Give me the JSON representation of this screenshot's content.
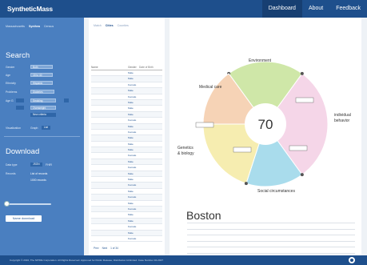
{
  "app": {
    "brand": "SyntheticMass",
    "nav": [
      "Dashboard",
      "About",
      "Feedback"
    ],
    "footer": "Copyright © 2016, The MITRE Corporation. All Rights Reserved. Approved for Public Release; Distribution Unlimited. Case Number 16-2027"
  },
  "sidebar": {
    "subtabs": [
      "Massachusetts",
      "Synthea",
      "Census"
    ],
    "search_title": "Search",
    "fields": [
      {
        "label": "Gender",
        "value": "Both"
      },
      {
        "label": "Age",
        "value": "18 to 40"
      },
      {
        "label": "Ethnicity",
        "value": "Hispanic"
      },
      {
        "label": "Problems",
        "value": "Diabetes"
      }
    ],
    "row5_label": "Age G",
    "row5_value": "Smoking",
    "row6_value": "Overweight",
    "new_criteria": "New criteria",
    "visualization_label": "Visualization",
    "viz_options": [
      "Graph",
      "List"
    ],
    "download_title": "Download",
    "download_label": "Data type",
    "download_options": [
      "JSON",
      "FHIR"
    ],
    "records_label": "Records",
    "records_value": "List of records",
    "records_count": "1000 records",
    "download_button": "Name download"
  },
  "results": {
    "tabs": [
      "Match",
      "Cities",
      "Counties"
    ],
    "columns": [
      "Name",
      "Gender",
      "Date of Birth"
    ],
    "rows": [
      {
        "name": "",
        "sex": "Male",
        "dob": ""
      },
      {
        "name": "",
        "sex": "Male",
        "dob": ""
      },
      {
        "name": "",
        "sex": "Female",
        "dob": ""
      },
      {
        "name": "",
        "sex": "Male",
        "dob": ""
      },
      {
        "name": "",
        "sex": "Female",
        "dob": ""
      },
      {
        "name": "",
        "sex": "Male",
        "dob": ""
      },
      {
        "name": "",
        "sex": "Male",
        "dob": ""
      },
      {
        "name": "",
        "sex": "Male",
        "dob": ""
      },
      {
        "name": "",
        "sex": "Female",
        "dob": ""
      },
      {
        "name": "",
        "sex": "Male",
        "dob": ""
      },
      {
        "name": "",
        "sex": "Female",
        "dob": ""
      },
      {
        "name": "",
        "sex": "Male",
        "dob": ""
      },
      {
        "name": "",
        "sex": "Male",
        "dob": ""
      },
      {
        "name": "",
        "sex": "Male",
        "dob": ""
      },
      {
        "name": "",
        "sex": "Female",
        "dob": ""
      },
      {
        "name": "",
        "sex": "Male",
        "dob": ""
      },
      {
        "name": "",
        "sex": "Female",
        "dob": ""
      },
      {
        "name": "",
        "sex": "Male",
        "dob": ""
      },
      {
        "name": "",
        "sex": "Male",
        "dob": ""
      },
      {
        "name": "",
        "sex": "Female",
        "dob": ""
      },
      {
        "name": "",
        "sex": "Male",
        "dob": ""
      },
      {
        "name": "",
        "sex": "Female",
        "dob": ""
      },
      {
        "name": "",
        "sex": "Male",
        "dob": ""
      },
      {
        "name": "",
        "sex": "Female",
        "dob": ""
      },
      {
        "name": "",
        "sex": "Male",
        "dob": ""
      },
      {
        "name": "",
        "sex": "Male",
        "dob": ""
      },
      {
        "name": "",
        "sex": "Female",
        "dob": ""
      },
      {
        "name": "",
        "sex": "Male",
        "dob": ""
      },
      {
        "name": "",
        "sex": "Female",
        "dob": ""
      }
    ],
    "pager": [
      "Prev",
      "Next",
      "1 of 34"
    ]
  },
  "chart_data": {
    "type": "pie",
    "center_value": "70",
    "categories": [
      "Environment",
      "Individual behavior",
      "Social circumstances",
      "Genetics & biology",
      "Medical care"
    ],
    "colors": [
      "#cfe7a8",
      "#f5d6e8",
      "#a9dcec",
      "#f6edb0",
      "#f6d3b6"
    ],
    "values": [
      0.2,
      0.3,
      0.15,
      0.2,
      0.15
    ],
    "labels": {
      "environment": "Environment",
      "individual": "individual",
      "behavior": "behavior",
      "social": "Social circumstances",
      "genetics": "Genetics",
      "biology": "& biology",
      "medical": "Medical care"
    },
    "callouts": [
      "",
      "",
      "",
      ""
    ]
  },
  "place": {
    "name": "Boston",
    "header": "",
    "stats": [
      [
        "",
        "",
        "",
        "",
        "",
        ""
      ],
      [
        "",
        "",
        "",
        "",
        "",
        ""
      ],
      [
        "",
        "",
        "",
        "",
        "",
        ""
      ],
      [
        "",
        "",
        "",
        "",
        "",
        ""
      ],
      [
        "",
        "",
        "",
        "",
        "",
        ""
      ],
      [
        "",
        "",
        "",
        "",
        "",
        ""
      ]
    ]
  }
}
